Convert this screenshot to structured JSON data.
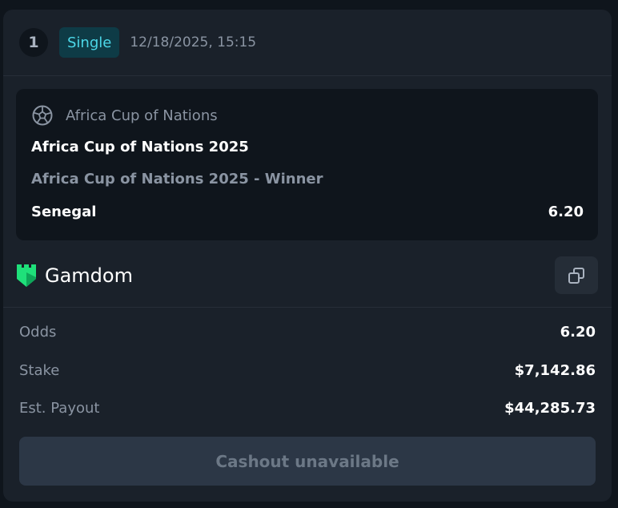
{
  "bet": {
    "number": "1",
    "type_badge": "Single",
    "timestamp": "12/18/2025, 15:15"
  },
  "event": {
    "competition": "Africa Cup of Nations",
    "event_name": "Africa Cup of Nations 2025",
    "market": "Africa Cup of Nations 2025 - Winner",
    "selection": "Senegal",
    "odds": "6.20"
  },
  "brand": {
    "name": "Gamdom",
    "logo_color": "#1fe07a"
  },
  "summary": [
    {
      "label": "Odds",
      "value": "6.20"
    },
    {
      "label": "Stake",
      "value": "$7,142.86"
    },
    {
      "label": "Est. Payout",
      "value": "$44,285.73"
    }
  ],
  "cashout_label": "Cashout unavailable",
  "icons": {
    "sport": "soccer-ball-icon",
    "copy": "copy-icon",
    "brand": "gamdom-castle-logo"
  }
}
